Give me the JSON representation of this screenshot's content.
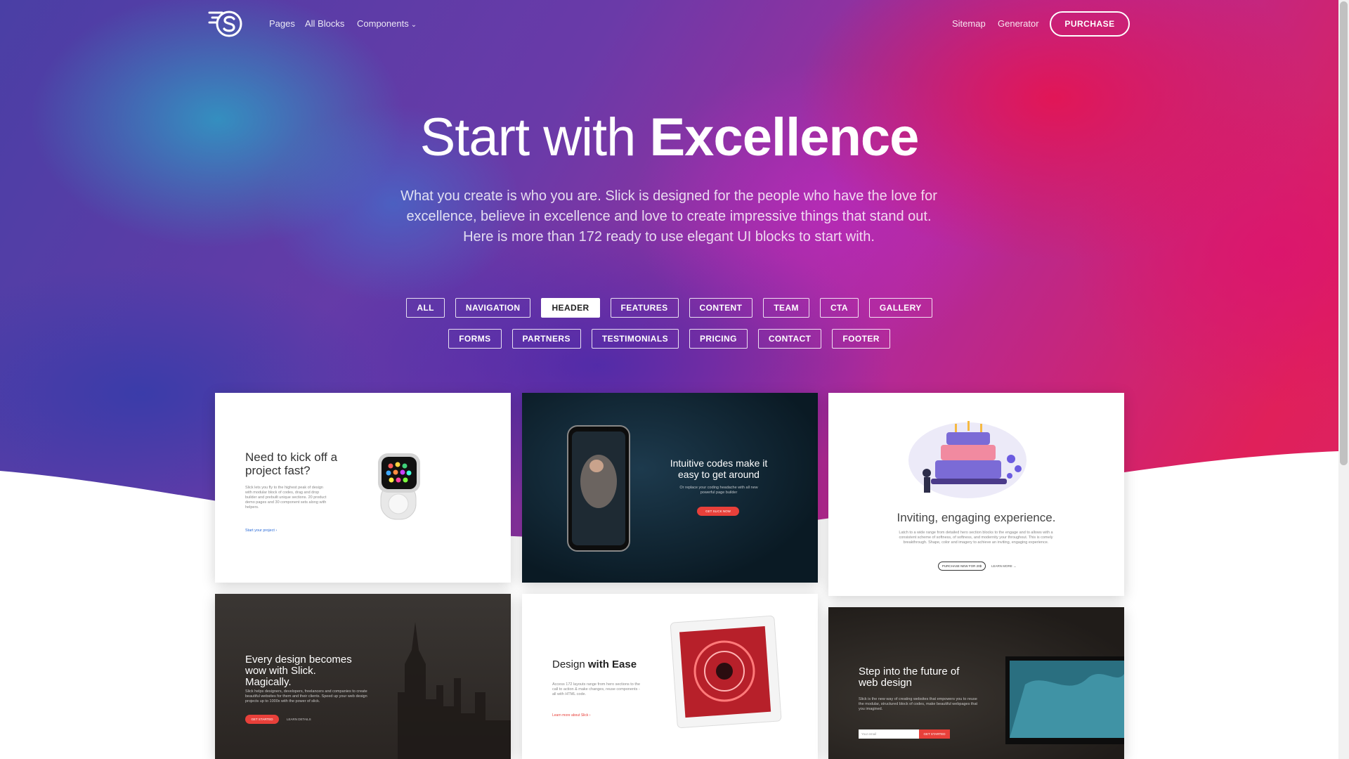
{
  "nav": {
    "links": [
      "Pages",
      "All Blocks",
      "Components"
    ],
    "right_links": [
      "Sitemap",
      "Generator"
    ],
    "purchase": "PURCHASE"
  },
  "hero": {
    "title_light": "Start with",
    "title_bold": "Excellence",
    "description": "What you create is who you are. Slick is designed for the people who have the love for excellence, believe in excellence and love to create impressive things that stand out. Here is more than 172 ready to use elegant UI blocks to start with."
  },
  "filters": {
    "row1": [
      "ALL",
      "NAVIGATION",
      "HEADER",
      "FEATURES",
      "CONTENT",
      "TEAM",
      "CTA",
      "GALLERY"
    ],
    "row2": [
      "FORMS",
      "PARTNERS",
      "TESTIMONIALS",
      "PRICING",
      "CONTACT",
      "FOOTER"
    ],
    "active": "HEADER"
  },
  "cards": {
    "c1": {
      "title": "Need to kick off a project fast?",
      "body": "Slick lets you fly to the highest peak of design with modular block of codes, drag and drop builder and prebuilt unique sections. 20 product demo pages and 30 component sets along with helpers.",
      "link": "Start your project"
    },
    "c2": {
      "title": "Intuitive codes make it easy to get around",
      "body": "Or replace your coding headache with all new powerful page builder",
      "button": "GET SLICK NOW"
    },
    "c3": {
      "title": "Inviting, engaging experience.",
      "body": "Latch to a wide range from detailed hero section blocks to the engage and to allows with a consistent scheme of softness, of softness, and modernity your throughout. This is comely breakthrough. Shape, color and imagery to achieve an inviting, engaging experience.",
      "button": "PURCHASE NEW FOR 20$",
      "link": "LEARN MORE"
    },
    "c4": {
      "title": "Every design becomes wow with Slick. Magically.",
      "body": "Slick helps designers, developers, freelancers and companies to create beautiful websites for them and their clients. Speed up your web design projects up to 1000x with the power of slick.",
      "button": "GET STARTED",
      "link": "LEARN DETAILS"
    },
    "c5": {
      "title_light": "Design",
      "title_bold": "with Ease",
      "body": "Access 172 layouts range from hero sections to the call to action & make changes, reuse components - all with HTML code.",
      "link": "Learn more about Slick"
    },
    "c6": {
      "title": "Step into the future of web design",
      "body": "Slick is the new way of creating websites that empowers you to reuse the modular, structured block of codes, make beautiful webpages that you imagined.",
      "input_placeholder": "Your email",
      "button": "GET STARTED"
    }
  }
}
